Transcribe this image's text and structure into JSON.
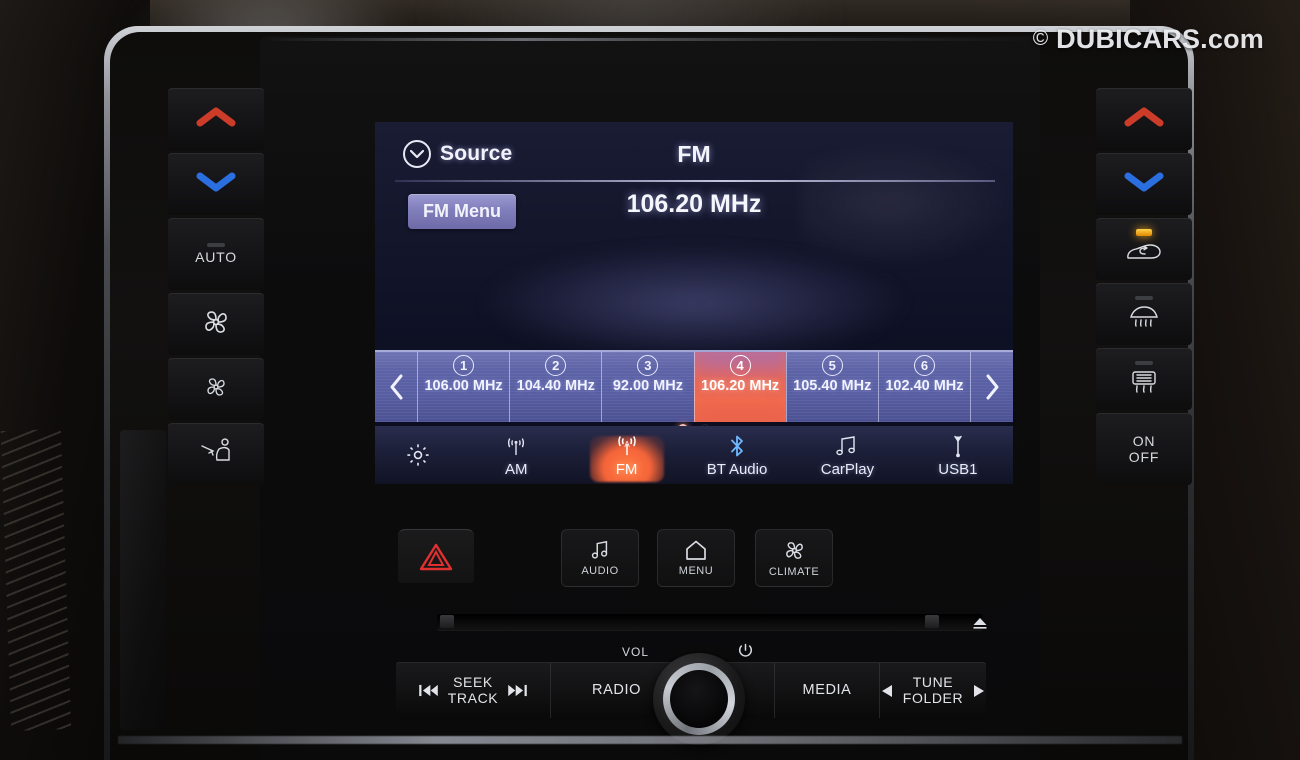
{
  "watermark": {
    "symbol": "©",
    "text": "DUBICARS.com"
  },
  "screen": {
    "header": {
      "source_label": "Source",
      "source_icon": "circle-chevron-down-icon",
      "band": "FM"
    },
    "fm_menu_button": "FM Menu",
    "current_frequency": "106.20 MHz",
    "presets": {
      "prev_arrow_icon": "chevron-left-icon",
      "next_arrow_icon": "chevron-right-icon",
      "items": [
        {
          "number": "1",
          "freq": "106.00 MHz",
          "active": false
        },
        {
          "number": "2",
          "freq": "104.40 MHz",
          "active": false
        },
        {
          "number": "3",
          "freq": "92.00 MHz",
          "active": false
        },
        {
          "number": "4",
          "freq": "106.20 MHz",
          "active": true
        },
        {
          "number": "5",
          "freq": "105.40 MHz",
          "active": false
        },
        {
          "number": "6",
          "freq": "102.40 MHz",
          "active": false
        }
      ],
      "page_dots": [
        {
          "active": true
        },
        {
          "active": false
        }
      ]
    },
    "source_bar": {
      "settings_icon": "gear-icon",
      "items": [
        {
          "label": "AM",
          "icon": "am-antenna-icon",
          "active": false
        },
        {
          "label": "FM",
          "icon": "fm-antenna-icon",
          "active": true
        },
        {
          "label": "BT Audio",
          "icon": "bluetooth-icon",
          "active": false
        },
        {
          "label": "CarPlay",
          "icon": "music-notes-icon",
          "active": false
        },
        {
          "label": "USB1",
          "icon": "usb-icon",
          "active": false
        }
      ]
    },
    "colors": {
      "screen_bg": "#0e1024",
      "preset_strip": "#5d63a6",
      "active_preset": "#f06a4e",
      "fm_menu": "#807dbb",
      "active_source": "#ff7a40"
    }
  },
  "soft_keys": {
    "hazard": {
      "icon": "hazard-triangle-icon",
      "color": "#e03030"
    },
    "items": [
      {
        "label": "AUDIO",
        "icon": "music-note-icon"
      },
      {
        "label": "MENU",
        "icon": "home-icon"
      },
      {
        "label": "CLIMATE",
        "icon": "fan-icon"
      }
    ]
  },
  "disc": {
    "eject_icon": "eject-icon"
  },
  "control_bar": {
    "seek": {
      "line1": "SEEK",
      "line2": "TRACK",
      "prev_icon": "skip-back-icon",
      "next_icon": "skip-forward-icon"
    },
    "radio": "RADIO",
    "vol_label": "VOL",
    "power_icon": "power-icon",
    "media": "MEDIA",
    "tune": {
      "line1": "TUNE",
      "line2": "FOLDER",
      "left_icon": "triangle-left-icon",
      "right_icon": "triangle-right-icon"
    }
  },
  "climate_left": {
    "buttons": [
      {
        "label": "",
        "icon": "chevron-up-red-icon",
        "led": "none"
      },
      {
        "label": "",
        "icon": "chevron-down-blue-icon",
        "led": "none"
      },
      {
        "label": "AUTO",
        "icon": "",
        "led": "dash"
      },
      {
        "label": "",
        "icon": "fan-up-icon",
        "led": "none"
      },
      {
        "label": "",
        "icon": "fan-down-icon",
        "led": "none"
      },
      {
        "label": "",
        "icon": "airflow-mode-icon",
        "led": "none"
      }
    ]
  },
  "climate_right": {
    "buttons": [
      {
        "label": "",
        "icon": "chevron-up-red-icon",
        "led": "none"
      },
      {
        "label": "",
        "icon": "chevron-down-blue-icon",
        "led": "none"
      },
      {
        "label": "",
        "icon": "recirculation-icon",
        "led": "amber"
      },
      {
        "label": "",
        "icon": "front-defrost-icon",
        "led": "dash"
      },
      {
        "label": "",
        "icon": "rear-defrost-icon",
        "led": "dash"
      },
      {
        "label": "ON\nOFF",
        "icon": "",
        "led": "none"
      }
    ],
    "onoff_line1": "ON",
    "onoff_line2": "OFF"
  }
}
